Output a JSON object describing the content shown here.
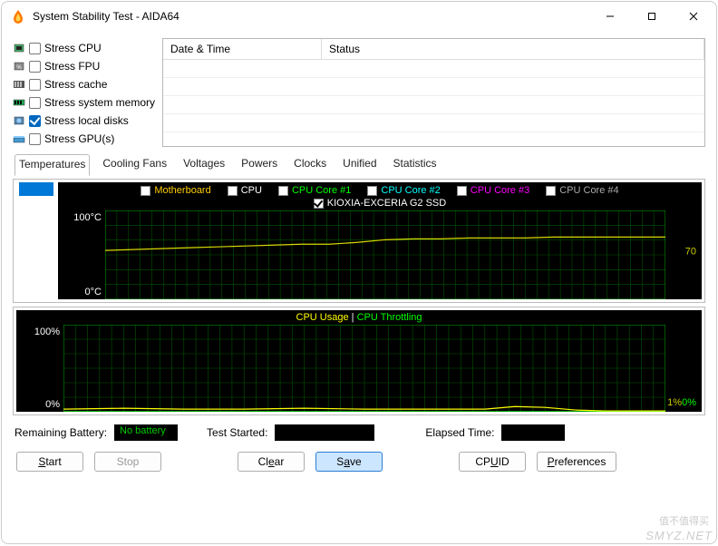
{
  "window": {
    "title": "System Stability Test - AIDA64"
  },
  "stress_options": [
    {
      "label": "Stress CPU",
      "checked": false,
      "icon": "cpu"
    },
    {
      "label": "Stress FPU",
      "checked": false,
      "icon": "fpu"
    },
    {
      "label": "Stress cache",
      "checked": false,
      "icon": "cache"
    },
    {
      "label": "Stress system memory",
      "checked": false,
      "icon": "mem"
    },
    {
      "label": "Stress local disks",
      "checked": true,
      "icon": "disk"
    },
    {
      "label": "Stress GPU(s)",
      "checked": false,
      "icon": "gpu"
    }
  ],
  "log_table": {
    "col_datetime": "Date & Time",
    "col_status": "Status"
  },
  "tabs": [
    "Temperatures",
    "Cooling Fans",
    "Voltages",
    "Powers",
    "Clocks",
    "Unified",
    "Statistics"
  ],
  "active_tab": 0,
  "temp_graph": {
    "y_max_label": "100°C",
    "y_min_label": "0°C",
    "right_value": "70",
    "legend": [
      {
        "label": "Motherboard",
        "color": "#ffcc00",
        "checked": false
      },
      {
        "label": "CPU",
        "color": "#ffffff",
        "checked": false
      },
      {
        "label": "CPU Core #1",
        "color": "#00ff00",
        "checked": false
      },
      {
        "label": "CPU Core #2",
        "color": "#00ffff",
        "checked": false
      },
      {
        "label": "CPU Core #3",
        "color": "#ff00ff",
        "checked": false
      },
      {
        "label": "CPU Core #4",
        "color": "#aaaaaa",
        "checked": false
      }
    ],
    "device_legend": {
      "label": "KIOXIA-EXCERIA G2 SSD",
      "checked": true,
      "color": "#d8d800"
    }
  },
  "usage_graph": {
    "y_max_label": "100%",
    "y_min_label": "0%",
    "title_usage": "CPU Usage",
    "title_sep": "  |  ",
    "title_throttle": "CPU Throttling",
    "right_usage": "1%",
    "right_throttle": "0%"
  },
  "status": {
    "battery_label": "Remaining Battery:",
    "battery_value": "No battery",
    "started_label": "Test Started:",
    "elapsed_label": "Elapsed Time:"
  },
  "buttons": {
    "start": "Start",
    "stop": "Stop",
    "clear": "Clear",
    "save": "Save",
    "cpuid": "CPUID",
    "prefs": "Preferences"
  },
  "watermark": {
    "top": "值不值得买",
    "main": "SMYZ.NET"
  },
  "chart_data": [
    {
      "type": "line",
      "title": "Temperature — KIOXIA-EXCERIA G2 SSD",
      "ylabel": "°C",
      "ylim": [
        0,
        100
      ],
      "x": [
        0,
        0.05,
        0.1,
        0.15,
        0.2,
        0.25,
        0.3,
        0.35,
        0.4,
        0.45,
        0.5,
        0.55,
        0.6,
        0.65,
        0.7,
        0.75,
        0.8,
        0.85,
        0.9,
        0.95,
        1.0
      ],
      "series": [
        {
          "name": "KIOXIA-EXCERIA G2 SSD",
          "color": "#d8d800",
          "values": [
            55,
            56,
            57,
            58,
            59,
            60,
            61,
            62,
            62,
            64,
            67,
            68,
            68,
            69,
            69,
            69,
            70,
            70,
            70,
            70,
            70
          ]
        }
      ],
      "right_end_value": 70
    },
    {
      "type": "line",
      "title": "CPU Usage | CPU Throttling",
      "ylabel": "%",
      "ylim": [
        0,
        100
      ],
      "x": [
        0,
        0.1,
        0.2,
        0.3,
        0.4,
        0.5,
        0.6,
        0.7,
        0.75,
        0.8,
        0.85,
        0.9,
        1.0
      ],
      "series": [
        {
          "name": "CPU Usage",
          "color": "#ffff00",
          "values": [
            3,
            4,
            3,
            3,
            4,
            3,
            3,
            3,
            6,
            5,
            2,
            1,
            1
          ]
        },
        {
          "name": "CPU Throttling",
          "color": "#00ff00",
          "values": [
            0,
            0,
            0,
            0,
            0,
            0,
            0,
            0,
            0,
            0,
            0,
            0,
            0
          ]
        }
      ],
      "right_end_values": {
        "CPU Usage": 1,
        "CPU Throttling": 0
      }
    }
  ]
}
